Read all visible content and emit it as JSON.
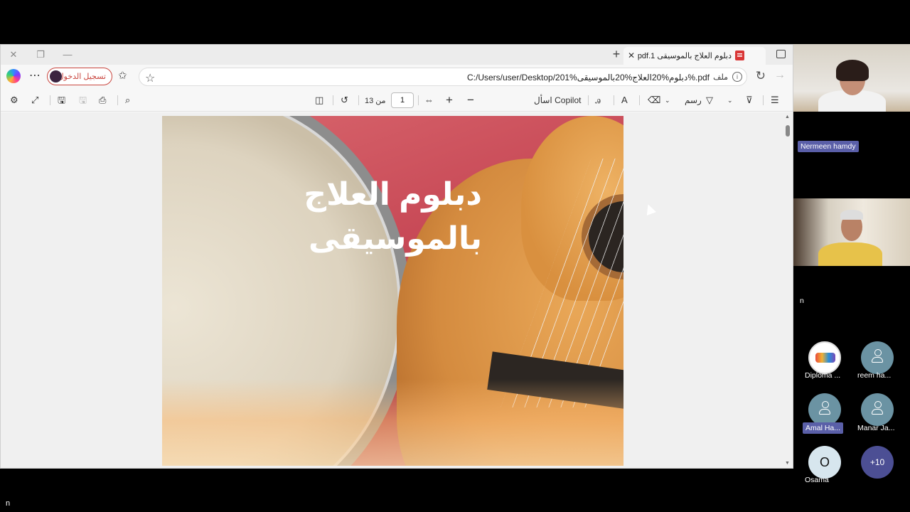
{
  "browser": {
    "tab_title": "دبلوم العلاج بالموسيقى pdf.1",
    "address_url": "C:/Users/user/Desktop/201%دبلوم%20العلاج%20بالموسيقى%.pdf",
    "address_file_label": "ملف",
    "signin_label": "تسجيل الدخول"
  },
  "pdf_toolbar": {
    "draw_label": "رسم",
    "copilot_label": "اسأل Copilot",
    "page_current": "1",
    "page_of": "من 13"
  },
  "pdf_page": {
    "title_line1": "دبلوم العلاج",
    "title_line2": "بالموسيقى"
  },
  "meeting": {
    "participant1_name": "Nermeen hamdy",
    "participant2_name": "n",
    "tiles": [
      {
        "name": "Diploma ..."
      },
      {
        "name": "reem ha..."
      },
      {
        "name": "Amal Ha..."
      },
      {
        "name": "Manar Ja..."
      },
      {
        "name": "Osama",
        "initial": "O"
      },
      {
        "name": "",
        "more": "+10"
      }
    ]
  },
  "footer_text": "n"
}
